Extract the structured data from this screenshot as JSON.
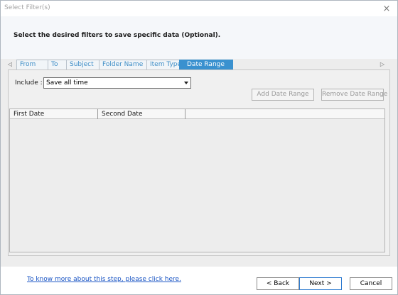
{
  "window": {
    "title": "Select Filter(s)",
    "close_glyph": "×"
  },
  "header": {
    "instruction": "Select the desired filters to save specific data (Optional)."
  },
  "tabs": {
    "scroll_left_glyph": "◁",
    "scroll_right_glyph": "▷",
    "items": [
      {
        "label": "From"
      },
      {
        "label": "To"
      },
      {
        "label": "Subject"
      },
      {
        "label": "Folder Name"
      },
      {
        "label": "Item Type"
      },
      {
        "label": "Date Range"
      }
    ],
    "active": "Date Range"
  },
  "date_range": {
    "include_label": "Include :",
    "include_value": "Save all time",
    "add_button": "Add Date Range",
    "remove_button": "Remove Date Range",
    "columns": [
      "First Date",
      "Second Date"
    ]
  },
  "footer": {
    "help_link": "To know more about this step, please click here.",
    "back_button": "< Back",
    "next_button": "Next >",
    "cancel_button": "Cancel"
  },
  "icons": {
    "close": "close-icon",
    "dropdown": "chevron-down-icon",
    "scroll_left": "scroll-left-icon",
    "scroll_right": "scroll-right-icon"
  },
  "colors": {
    "accent": "#3a91cf",
    "tab_text": "#3d8dc6",
    "link": "#1a55c4",
    "primary_button_border": "#2e7bd0"
  }
}
